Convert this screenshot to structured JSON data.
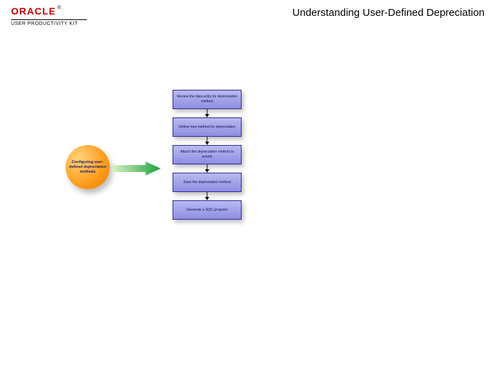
{
  "header": {
    "brand": "ORACLE",
    "tm": "®",
    "product": "USER PRODUCTIVITY KIT",
    "title": "Understanding User-Defined Depreciation"
  },
  "diagram": {
    "circle_label": "Configuring user-defined depreciation methods",
    "steps": [
      "Review the data entry for depreciation method",
      "Define new method for depreciation",
      "Attach the depreciation method to assets",
      "Save the depreciation method",
      "Generate a SQC program"
    ]
  },
  "colors": {
    "brand_red": "#c00000",
    "step_fill_top": "#b9b9f0",
    "step_fill_bottom": "#8e8ee0",
    "step_border": "#2a2a9a",
    "circle_inner": "#ffd47a",
    "circle_outer": "#e07a00",
    "arrow_start": "#d6f2c4",
    "arrow_end": "#1aa33a"
  }
}
